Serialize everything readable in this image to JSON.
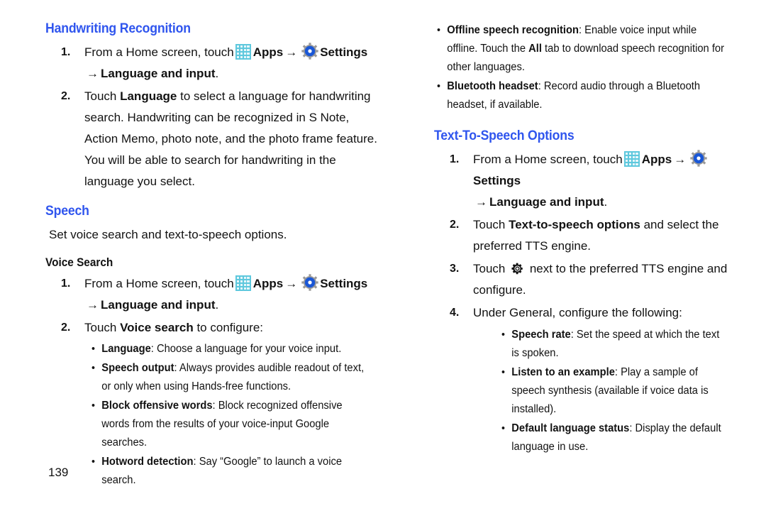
{
  "page": {
    "number": "139",
    "accent_color": "#2f55ee",
    "text_color": "#121212",
    "background": "#ffffff"
  },
  "icons": {
    "apps": "apps-grid-icon",
    "settings": "settings-gear-icon",
    "cog": "cog-icon",
    "arrow": "→"
  },
  "left_column": {
    "handwriting": {
      "heading": "Handwriting Recognition",
      "steps": [
        {
          "num": "1.",
          "pre": "From a Home screen, touch",
          "apps_label": "Apps",
          "settings_label": "Settings",
          "second_line_bold": "Language and input",
          "second_line_tail": "."
        },
        {
          "num": "2.",
          "text_1": "Touch ",
          "bold_1": "Language",
          "text_2": " to select a language for handwriting search. Handwriting can be recognized in S Note, Action Memo, photo note, and the photo frame feature. You will be able to search for handwriting in the language you select."
        }
      ]
    },
    "speech": {
      "heading": "Speech",
      "intro": "Set voice search and text-to-speech options.",
      "voice_search": {
        "subheading": "Voice Search",
        "steps": [
          {
            "num": "1.",
            "pre": "From a Home screen, touch",
            "apps_label": "Apps",
            "settings_label": "Settings",
            "second_line_bold": "Language and input",
            "second_line_tail": "."
          },
          {
            "num": "2.",
            "text_1": "Touch ",
            "bold_1": "Voice search",
            "text_2": " to configure:"
          }
        ],
        "bullets": [
          {
            "term": "Language",
            "desc": ": Choose a language for your voice input."
          },
          {
            "term": "Speech output",
            "desc": ": Always provides audible readout of text, or only when using Hands-free functions."
          },
          {
            "term": "Block offensive words",
            "desc": ": Block recognized offensive words from the results of your voice-input Google searches."
          },
          {
            "term": "Hotword detection",
            "desc": ": Say “Google” to launch a voice search."
          }
        ]
      }
    }
  },
  "right_column": {
    "top_bullets": [
      {
        "term": "Offline speech recognition",
        "desc_1": ": Enable voice input while offline. Touch the ",
        "bold_2": "All",
        "desc_2": " tab to download speech recognition for other languages."
      },
      {
        "term": "Bluetooth headset",
        "desc_1": ": Record audio through a Bluetooth headset, if available.",
        "bold_2": "",
        "desc_2": ""
      }
    ],
    "tts": {
      "heading": "Text-To-Speech Options",
      "steps": [
        {
          "num": "1.",
          "pre": "From a Home screen, touch",
          "apps_label": "Apps",
          "settings_label": "Settings",
          "second_line_bold": "Language and input",
          "second_line_tail": "."
        },
        {
          "num": "2.",
          "text_1": "Touch ",
          "bold_1": "Text-to-speech options",
          "text_2": " and select the preferred TTS engine."
        },
        {
          "num": "3.",
          "text_1": "Touch ",
          "text_2": " next to the preferred TTS engine and configure."
        },
        {
          "num": "4.",
          "text_1": "Under General, configure the following:",
          "text_2": ""
        }
      ],
      "bullets": [
        {
          "term": "Speech rate",
          "desc": ": Set the speed at which the text is spoken."
        },
        {
          "term": "Listen to an example",
          "desc": ": Play a sample of speech synthesis (available if voice data is installed)."
        },
        {
          "term": "Default language status",
          "desc": ": Display the default language in use."
        }
      ]
    }
  }
}
